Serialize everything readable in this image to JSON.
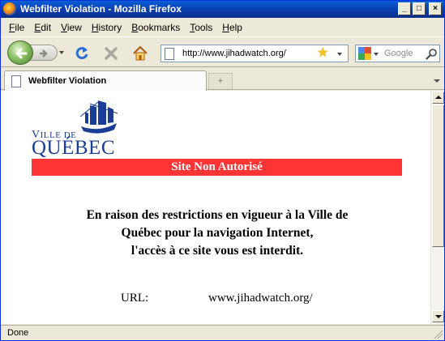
{
  "window": {
    "title": "Webfilter Violation - Mozilla Firefox"
  },
  "menu": [
    {
      "label": "File",
      "accel": "F",
      "rest": "ile"
    },
    {
      "label": "Edit",
      "accel": "E",
      "rest": "dit"
    },
    {
      "label": "View",
      "accel": "V",
      "rest": "iew"
    },
    {
      "label": "History",
      "accel": "H",
      "rest": "istory"
    },
    {
      "label": "Bookmarks",
      "accel": "B",
      "rest": "ookmarks"
    },
    {
      "label": "Tools",
      "accel": "T",
      "rest": "ools"
    },
    {
      "label": "Help",
      "accel": "H",
      "rest": "elp"
    }
  ],
  "toolbar": {
    "url": "http://www.jihadwatch.org/",
    "search_placeholder": "Google"
  },
  "tab": {
    "label": "Webfilter Violation",
    "new_tab_glyph": "+"
  },
  "page": {
    "logo_ville_first": "V",
    "logo_ville_rest": "ILLE DE",
    "logo_quebec": "QUÉBEC",
    "banner": "Site Non Autorisé",
    "message_lines": [
      "En raison des restrictions en vigueur à la Ville de",
      "Québec pour la navigation Internet,",
      "l'accès à ce site vous est interdit."
    ],
    "url_label": "URL:",
    "url_value": "www.jihadwatch.org/"
  },
  "status": {
    "text": "Done"
  },
  "colors": {
    "banner": "#ff3434",
    "logo_blue": "#1c3d95"
  },
  "icons": {
    "back": "back-arrow-icon",
    "forward": "forward-arrow-icon",
    "reload": "reload-icon",
    "stop": "stop-icon",
    "home": "home-icon",
    "bookmark": "star-icon",
    "search": "magnifier-icon"
  }
}
